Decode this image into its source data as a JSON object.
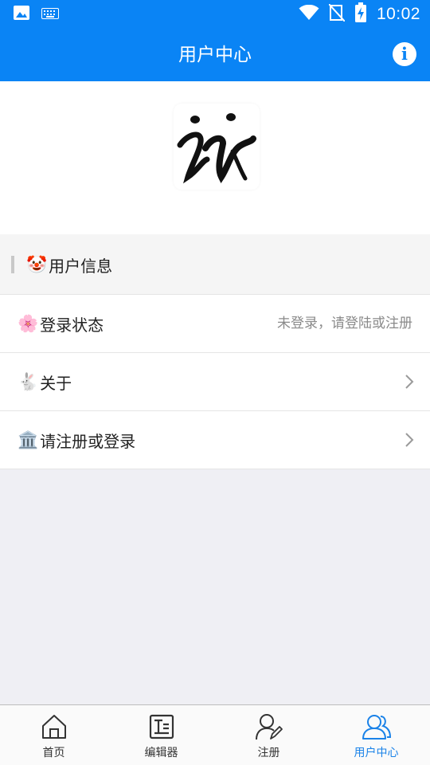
{
  "status_bar": {
    "time": "10:02",
    "icons": [
      "image-icon",
      "keyboard-icon",
      "wifi-icon",
      "no-signal-icon",
      "battery-charging-icon"
    ]
  },
  "app_bar": {
    "title": "用户中心",
    "action_icon": "info-icon",
    "action_glyph": "i"
  },
  "logo": {
    "icon": "app-logo-calligraphy"
  },
  "section": {
    "icon_emoji": "🤡",
    "title": "用户信息"
  },
  "rows": [
    {
      "icon_emoji": "🌸",
      "label": "登录状态",
      "value": "未登录，请登陆或注册"
    },
    {
      "icon_emoji": "🐇",
      "label": "关于",
      "chevron": true
    },
    {
      "icon_emoji": "🏛️",
      "label": "请注册或登录",
      "chevron": true
    }
  ],
  "bottom_nav": {
    "items": [
      {
        "label": "首页",
        "icon": "home-icon",
        "active": false
      },
      {
        "label": "编辑器",
        "icon": "editor-icon",
        "active": false
      },
      {
        "label": "注册",
        "icon": "register-user-icon",
        "active": false
      },
      {
        "label": "用户中心",
        "icon": "user-center-icon",
        "active": true
      }
    ]
  },
  "colors": {
    "primary": "#0a84f5",
    "active_tab": "#1a82e8",
    "background": "#efeff4"
  }
}
